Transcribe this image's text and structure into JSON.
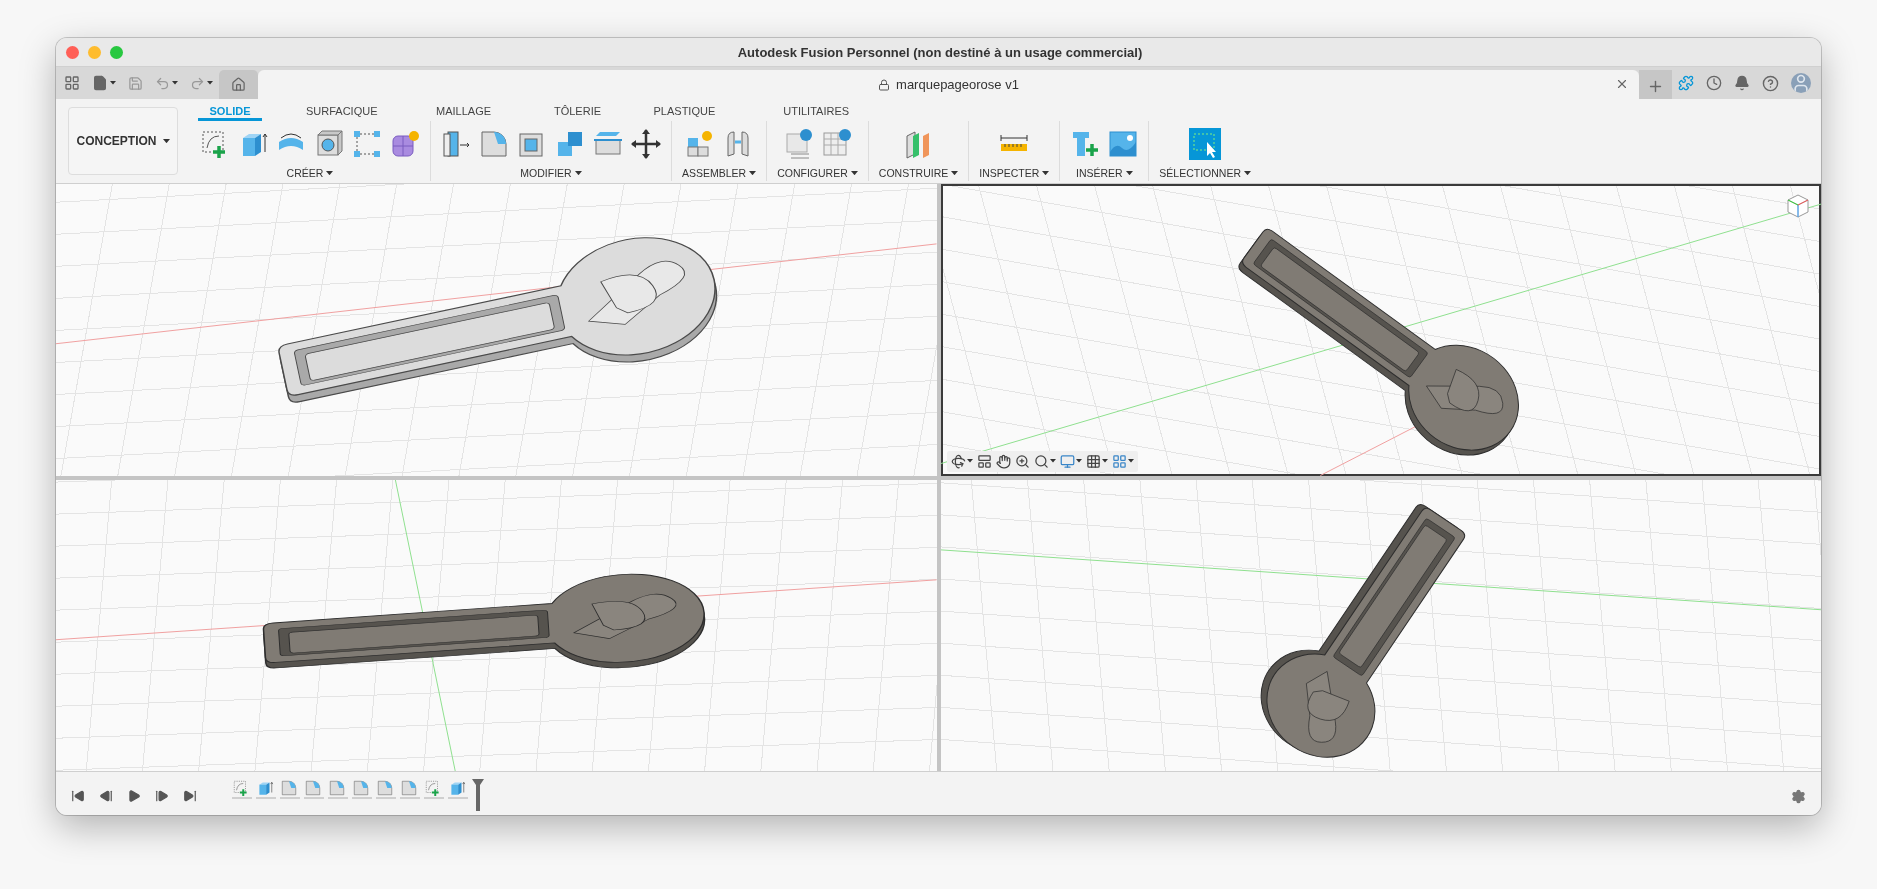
{
  "window": {
    "title": "Autodesk Fusion Personnel (non destiné à un usage commercial)"
  },
  "document_tab": {
    "title": "marquepageorose v1"
  },
  "workspace": {
    "label": "CONCEPTION"
  },
  "toolbar_tabs": [
    {
      "label": "SOLIDE",
      "selected": true
    },
    {
      "label": "SURFACIQUE",
      "selected": false
    },
    {
      "label": "MAILLAGE",
      "selected": false
    },
    {
      "label": "TÔLERIE",
      "selected": false
    },
    {
      "label": "PLASTIQUE",
      "selected": false
    },
    {
      "label": "UTILITAIRES",
      "selected": false
    }
  ],
  "tool_groups": [
    {
      "label": "CRÉER",
      "tools": [
        {
          "kind": "sketch"
        },
        {
          "kind": "extrude"
        },
        {
          "kind": "revolve"
        },
        {
          "kind": "hole"
        },
        {
          "kind": "pattern"
        },
        {
          "kind": "form"
        }
      ]
    },
    {
      "label": "MODIFIER",
      "tools": [
        {
          "kind": "press-pull"
        },
        {
          "kind": "fillet"
        },
        {
          "kind": "shell"
        },
        {
          "kind": "combine"
        },
        {
          "kind": "offset-face"
        },
        {
          "kind": "move"
        }
      ]
    },
    {
      "label": "ASSEMBLER",
      "tools": [
        {
          "kind": "new-component"
        },
        {
          "kind": "joint"
        }
      ]
    },
    {
      "label": "CONFIGURER",
      "tools": [
        {
          "kind": "parameters"
        },
        {
          "kind": "config-table"
        }
      ]
    },
    {
      "label": "CONSTRUIRE",
      "tools": [
        {
          "kind": "plane"
        }
      ]
    },
    {
      "label": "INSPECTER",
      "tools": [
        {
          "kind": "measure"
        }
      ]
    },
    {
      "label": "INSÉRER",
      "tools": [
        {
          "kind": "bolt"
        },
        {
          "kind": "canvas"
        }
      ]
    },
    {
      "label": "SÉLECTIONNER",
      "tools": [
        {
          "kind": "select"
        }
      ]
    }
  ],
  "viewports": [
    {
      "kind": "light",
      "active": false
    },
    {
      "kind": "dark",
      "active": true
    },
    {
      "kind": "dark",
      "active": false
    },
    {
      "kind": "dark",
      "active": false
    }
  ],
  "timeline": {
    "features": [
      {
        "kind": "sketch"
      },
      {
        "kind": "extrude"
      },
      {
        "kind": "fillet"
      },
      {
        "kind": "fillet"
      },
      {
        "kind": "fillet"
      },
      {
        "kind": "fillet"
      },
      {
        "kind": "fillet"
      },
      {
        "kind": "fillet"
      },
      {
        "kind": "sketch"
      },
      {
        "kind": "extrude"
      }
    ]
  }
}
